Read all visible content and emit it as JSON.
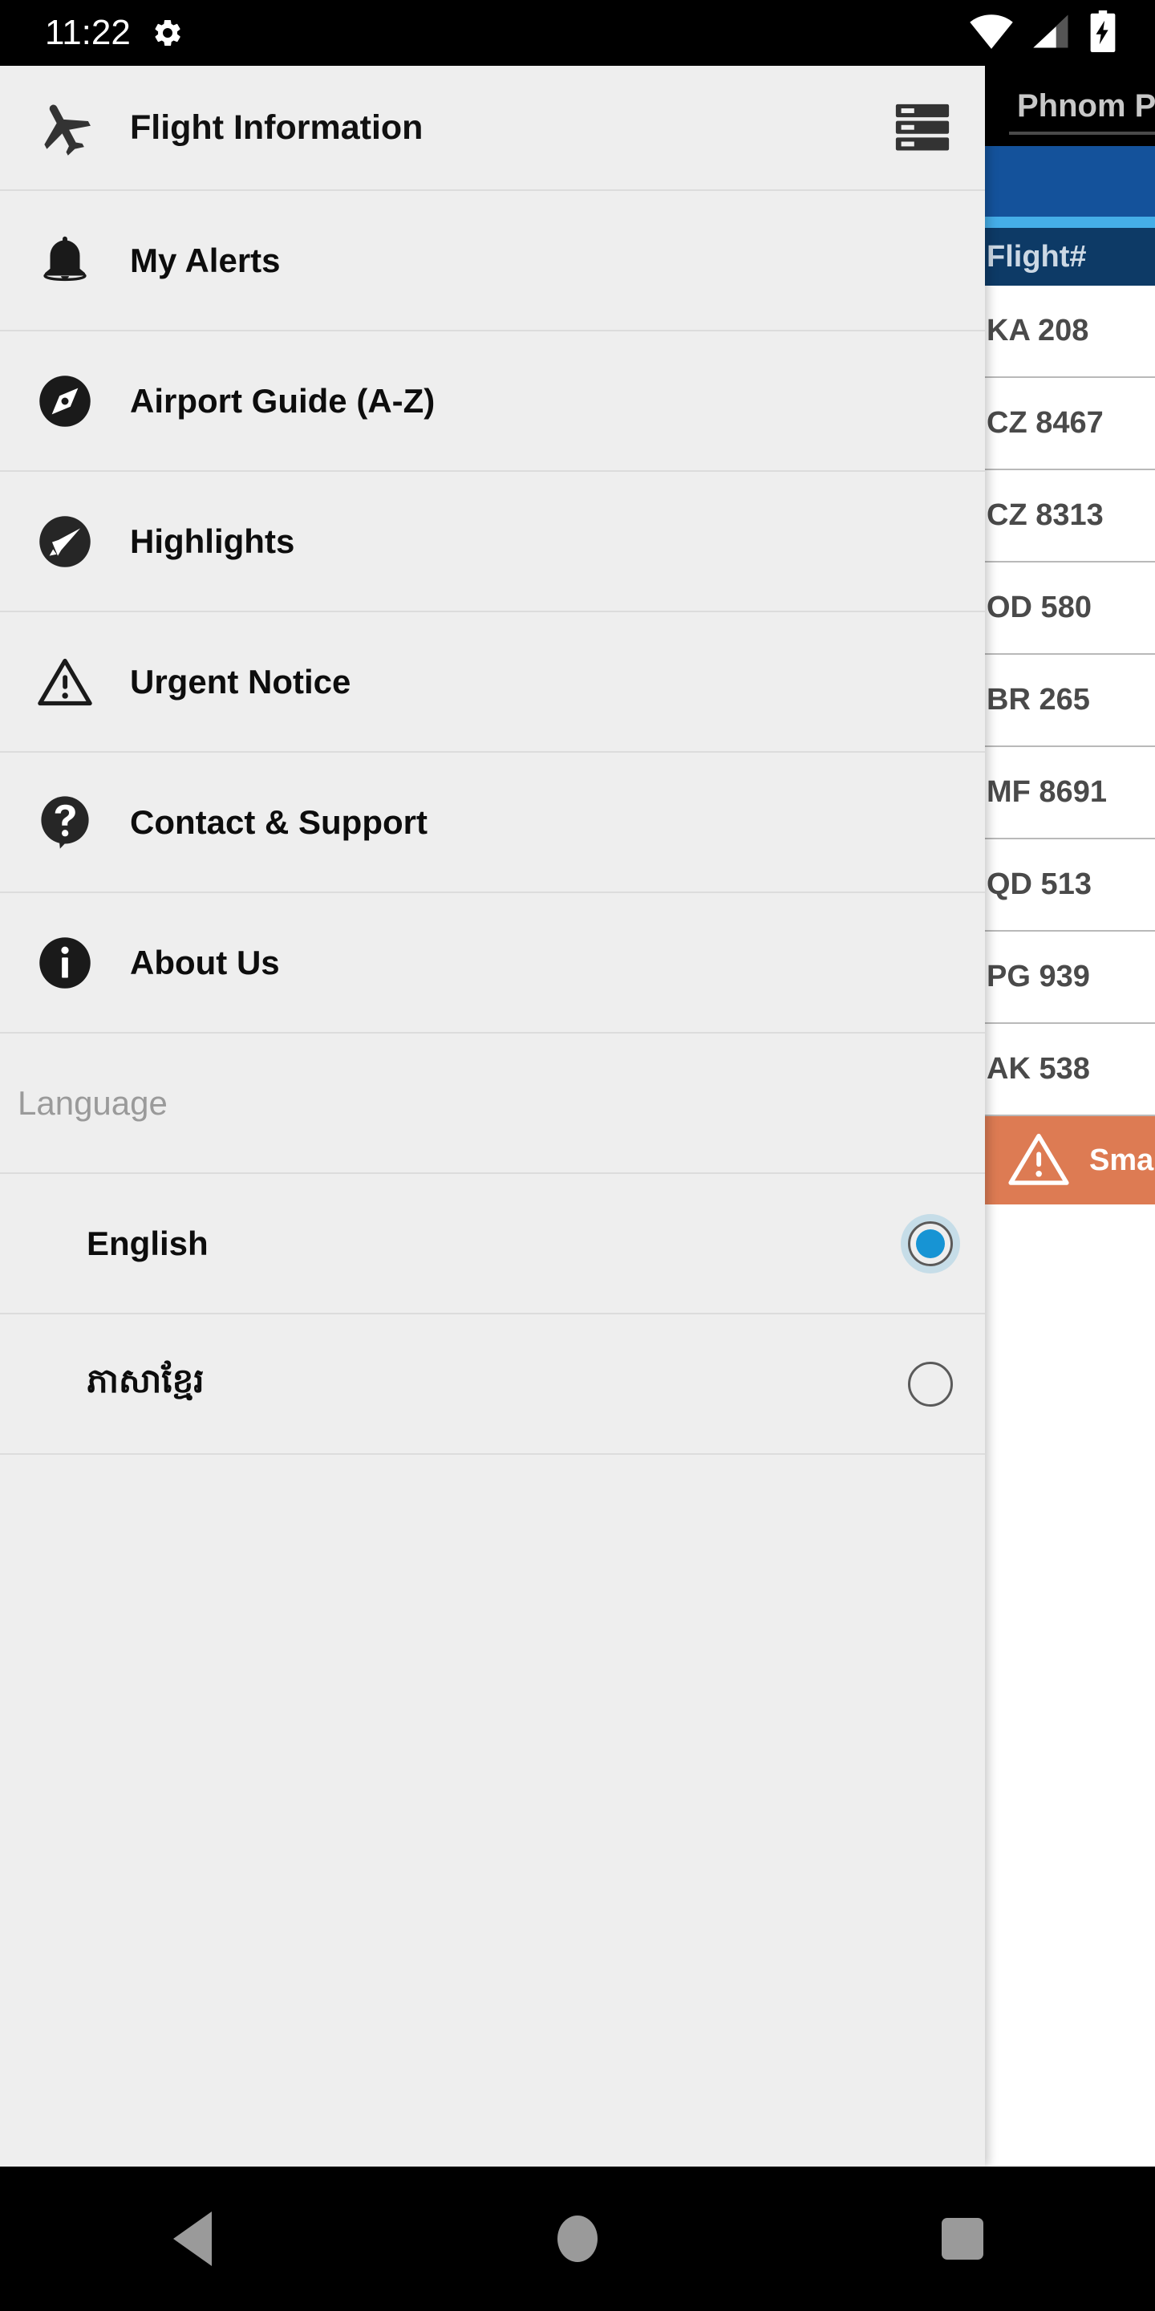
{
  "status_bar": {
    "time": "11:22",
    "icons": [
      "gear-icon",
      "wifi-icon",
      "cell-signal-icon",
      "battery-charging-icon"
    ]
  },
  "drawer": {
    "header": {
      "title": "Flight Information",
      "leading_icon": "airplane-icon",
      "trailing_icon": "flight-list-icon"
    },
    "menu_items": [
      {
        "label": "My Alerts",
        "icon": "bell-icon"
      },
      {
        "label": "Airport Guide (A-Z)",
        "icon": "compass-icon"
      },
      {
        "label": "Highlights",
        "icon": "megaphone-icon"
      },
      {
        "label": "Urgent Notice",
        "icon": "warning-triangle-icon"
      },
      {
        "label": "Contact & Support",
        "icon": "question-bubble-icon"
      },
      {
        "label": "About Us",
        "icon": "info-circle-icon"
      }
    ],
    "language_section": {
      "heading": "Language",
      "options": [
        {
          "label": "English",
          "selected": true
        },
        {
          "label": "ភាសាខ្មែរ",
          "selected": false
        }
      ]
    }
  },
  "flight_pane": {
    "title": "Phnom Penh",
    "column_header": "Flight#",
    "flights": [
      {
        "flight_number": "KA 208"
      },
      {
        "flight_number": "CZ 8467"
      },
      {
        "flight_number": "CZ 8313"
      },
      {
        "flight_number": "OD 580"
      },
      {
        "flight_number": "BR 265"
      },
      {
        "flight_number": "MF 8691"
      },
      {
        "flight_number": "QD 513"
      },
      {
        "flight_number": "PG 939"
      },
      {
        "flight_number": "AK 538"
      }
    ],
    "alert_banner": {
      "text": "Smart",
      "icon": "warning-triangle-icon"
    }
  },
  "nav_bar": {
    "back": "back-button",
    "home": "home-button",
    "recents": "recents-button"
  },
  "colors": {
    "drawer_bg": "#eeeeee",
    "accent_blue": "#14529b",
    "cyan_stripe": "#45aee8",
    "header_navy": "#0d3a66",
    "alert_orange": "#dd7b53",
    "radio_selected": "#1794d4"
  }
}
